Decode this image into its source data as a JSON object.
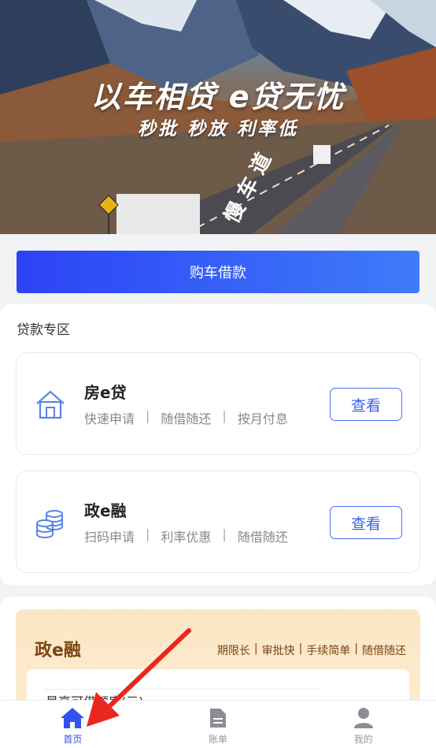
{
  "banner": {
    "title": "以车相贷  e贷无忧",
    "subtitle": "秒批  秒放  利率低"
  },
  "primary_button": {
    "label": "购车借款"
  },
  "loan_zone": {
    "title": "贷款专区",
    "cards": [
      {
        "name": "房e贷",
        "icon": "house-icon",
        "tags": [
          "快速申请",
          "随借随还",
          "按月付息"
        ],
        "button_label": "查看"
      },
      {
        "name": "政e融",
        "icon": "coins-icon",
        "tags": [
          "扫码申请",
          "利率优惠",
          "随借随还"
        ],
        "button_label": "查看"
      }
    ]
  },
  "promo": {
    "title": "政e融",
    "tags": [
      "期限长",
      "审批快",
      "手续简单",
      "随借随还"
    ],
    "label": "最高可借额度(元)"
  },
  "tabbar": {
    "items": [
      {
        "label": "首页",
        "icon": "home-icon",
        "active": true
      },
      {
        "label": "账单",
        "icon": "document-icon",
        "active": false
      },
      {
        "label": "我的",
        "icon": "user-icon",
        "active": false
      }
    ]
  },
  "colors": {
    "accent": "#2f52f0",
    "button_gradient_start": "#2c43f6",
    "button_gradient_end": "#3f7cf8",
    "promo_text": "#7a4513",
    "annotation_arrow": "#e8281f"
  }
}
